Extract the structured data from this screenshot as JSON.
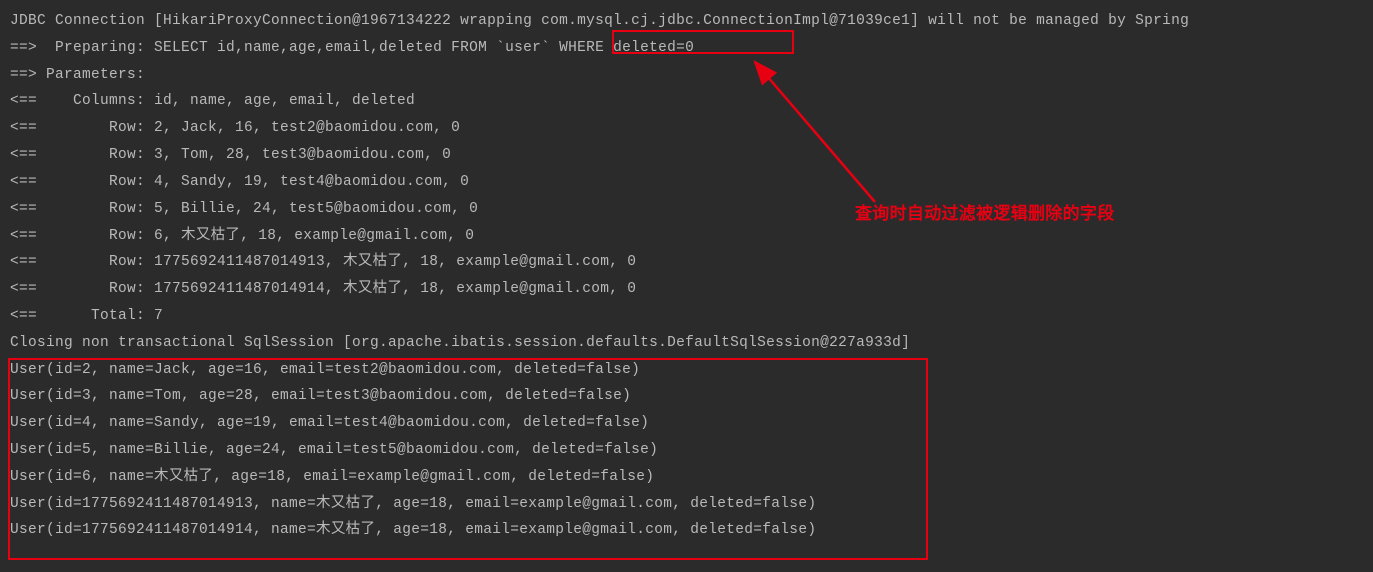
{
  "lines": [
    "JDBC Connection [HikariProxyConnection@1967134222 wrapping com.mysql.cj.jdbc.ConnectionImpl@71039ce1] will not be managed by Spring",
    "==>  Preparing: SELECT id,name,age,email,deleted FROM `user` WHERE deleted=0",
    "==> Parameters: ",
    "<==    Columns: id, name, age, email, deleted",
    "<==        Row: 2, Jack, 16, test2@baomidou.com, 0",
    "<==        Row: 3, Tom, 28, test3@baomidou.com, 0",
    "<==        Row: 4, Sandy, 19, test4@baomidou.com, 0",
    "<==        Row: 5, Billie, 24, test5@baomidou.com, 0",
    "<==        Row: 6, 木又枯了, 18, example@gmail.com, 0",
    "<==        Row: 1775692411487014913, 木又枯了, 18, example@gmail.com, 0",
    "<==        Row: 1775692411487014914, 木又枯了, 18, example@gmail.com, 0",
    "<==      Total: 7",
    "Closing non transactional SqlSession [org.apache.ibatis.session.defaults.DefaultSqlSession@227a933d]",
    "User(id=2, name=Jack, age=16, email=test2@baomidou.com, deleted=false)",
    "User(id=3, name=Tom, age=28, email=test3@baomidou.com, deleted=false)",
    "User(id=4, name=Sandy, age=19, email=test4@baomidou.com, deleted=false)",
    "User(id=5, name=Billie, age=24, email=test5@baomidou.com, deleted=false)",
    "User(id=6, name=木又枯了, age=18, email=example@gmail.com, deleted=false)",
    "User(id=1775692411487014913, name=木又枯了, age=18, email=example@gmail.com, deleted=false)",
    "User(id=1775692411487014914, name=木又枯了, age=18, email=example@gmail.com, deleted=false)"
  ],
  "annotation": "查询时自动过滤被逻辑删除的字段"
}
